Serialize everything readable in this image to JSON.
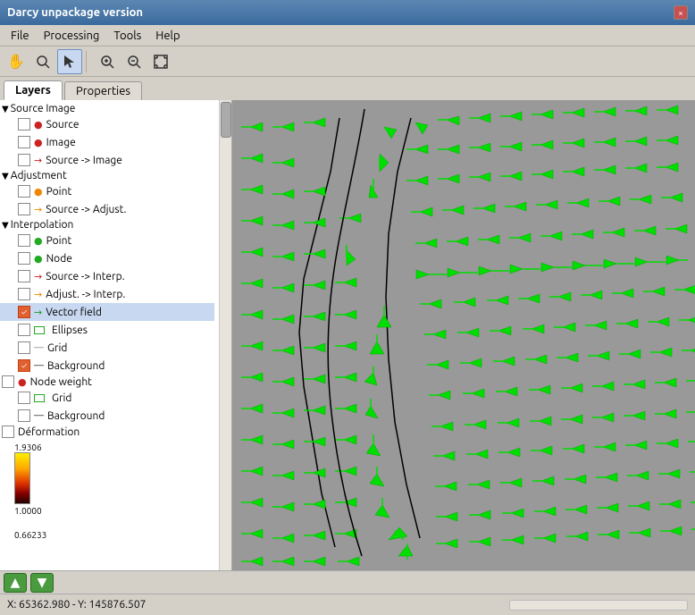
{
  "titleBar": {
    "title": "Darcy unpackage version",
    "closeLabel": "×"
  },
  "menuBar": {
    "items": [
      "File",
      "Processing",
      "Tools",
      "Help"
    ]
  },
  "toolbar": {
    "tools": [
      {
        "name": "pan",
        "icon": "✋",
        "active": false
      },
      {
        "name": "zoom-in-tool",
        "icon": "🔍",
        "active": false
      },
      {
        "name": "select",
        "icon": "↖",
        "active": true
      },
      {
        "name": "zoom-in",
        "icon": "+🔍",
        "active": false
      },
      {
        "name": "zoom-out",
        "icon": "−🔍",
        "active": false
      },
      {
        "name": "fit",
        "icon": "⛶",
        "active": false
      }
    ]
  },
  "tabs": {
    "items": [
      {
        "label": "Layers",
        "active": true
      },
      {
        "label": "Properties",
        "active": false
      }
    ]
  },
  "layers": {
    "groups": [
      {
        "name": "Source Image",
        "expanded": true,
        "items": [
          {
            "label": "Source",
            "checked": false,
            "iconType": "dot",
            "iconColor": "red"
          },
          {
            "label": "Image",
            "checked": false,
            "iconType": "dot",
            "iconColor": "red"
          },
          {
            "label": "Source -> Image",
            "checked": false,
            "iconType": "arrow",
            "iconColor": "red"
          }
        ]
      },
      {
        "name": "Adjustment",
        "expanded": true,
        "items": [
          {
            "label": "Point",
            "checked": false,
            "iconType": "dot",
            "iconColor": "orange"
          },
          {
            "label": "Source -> Adjust.",
            "checked": false,
            "iconType": "arrow",
            "iconColor": "orange"
          }
        ]
      },
      {
        "name": "Interpolation",
        "expanded": true,
        "items": [
          {
            "label": "Point",
            "checked": false,
            "iconType": "dot",
            "iconColor": "green"
          },
          {
            "label": "Node",
            "checked": false,
            "iconType": "dot",
            "iconColor": "green"
          },
          {
            "label": "Source -> Interp.",
            "checked": false,
            "iconType": "arrow",
            "iconColor": "red"
          },
          {
            "label": "Adjust. -> Interp.",
            "checked": false,
            "iconType": "arrow",
            "iconColor": "orange"
          },
          {
            "label": "Vector field",
            "checked": true,
            "iconType": "arrow",
            "iconColor": "green",
            "highlighted": true
          },
          {
            "label": "Ellipses",
            "checked": false,
            "iconType": "rect",
            "iconColor": "green"
          },
          {
            "label": "Grid",
            "checked": false,
            "iconType": "line",
            "iconColor": "gray"
          },
          {
            "label": "Background",
            "checked": true,
            "iconType": "line",
            "iconColor": "black"
          }
        ]
      },
      {
        "name": "Node weight",
        "isTopLevel": true,
        "items": [
          {
            "label": "Grid",
            "checked": false,
            "iconType": "rect",
            "iconColor": "green"
          },
          {
            "label": "Background",
            "checked": false,
            "iconType": "line",
            "iconColor": "black"
          }
        ]
      },
      {
        "name": "Déformation",
        "isTopLevel": true,
        "items": []
      }
    ],
    "colorbar": {
      "values": [
        "1.9306",
        "1.0000",
        "0.66233"
      ]
    }
  },
  "bottomToolbar": {
    "upLabel": "▲",
    "downLabel": "▼"
  },
  "statusBar": {
    "coords": "X: 65362.980 - Y: 145876.507"
  }
}
